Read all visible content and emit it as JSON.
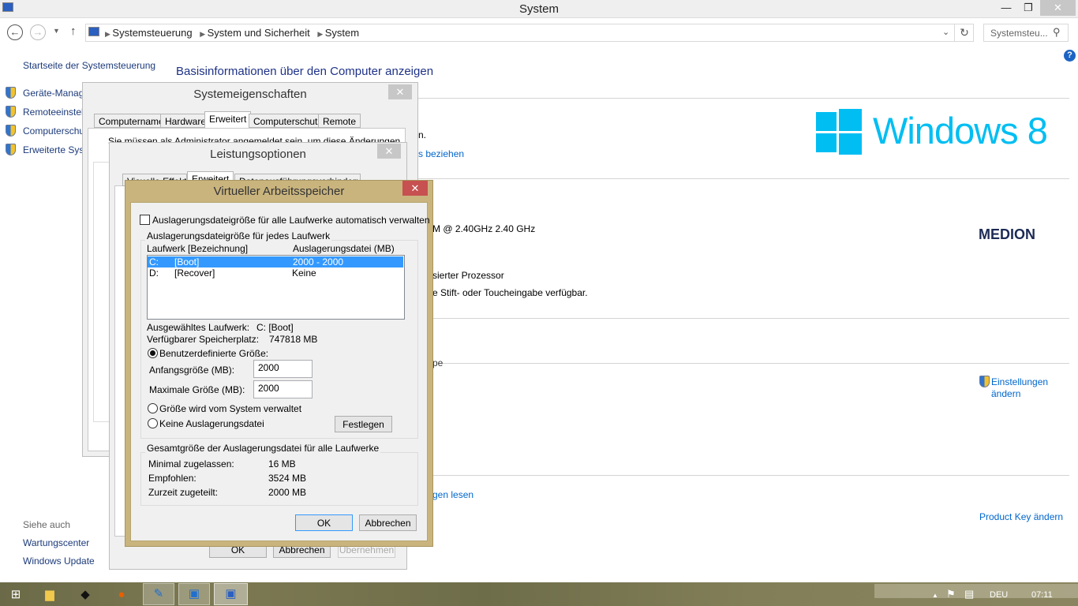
{
  "window": {
    "title": "System",
    "minimize": "—",
    "restore": "❐",
    "close": "✕"
  },
  "nav": {
    "breadcrumb": [
      "Systemsteuerung",
      "System und Sicherheit",
      "System"
    ],
    "search_placeholder": "Systemsteu..."
  },
  "sidebar": {
    "home": "Startseite der Systemsteuerung",
    "items": [
      {
        "label": "Geräte-Manag"
      },
      {
        "label": "Remoteeinstel"
      },
      {
        "label": "Computerschu"
      },
      {
        "label": "Erweiterte Syst"
      }
    ],
    "see_also": "Siehe auch",
    "see_also_items": [
      "Wartungscenter",
      "Windows Update"
    ]
  },
  "main": {
    "heading": "Basisinformationen über den Computer anzeigen",
    "frag1": "n.",
    "frag2": "s beziehen",
    "cpu": "M @ 2.40GHz   2.40 GHz",
    "frag3": "sierter Prozessor",
    "frag4": "e Stift- oder Toucheingabe verfügbar.",
    "frag5": "pe",
    "frag6": "gen lesen",
    "windows_logo": "Windows 8",
    "oem_logo": "MEDION",
    "settings_link_1": "Einstellungen",
    "settings_link_2": "ändern",
    "product_key": "Product Key ändern",
    "help": "?"
  },
  "sysprops": {
    "title": "Systemeigenschaften",
    "close": "✕",
    "tabs": [
      "Computername",
      "Hardware",
      "Erweitert",
      "Computerschutz",
      "Remote"
    ],
    "notice": "Sie müssen als Administrator angemeldet sein, um diese Änderungen"
  },
  "perf": {
    "title": "Leistungsoptionen",
    "close": "✕",
    "tabs": [
      "Visuelle Effekte",
      "Erweitert",
      "Datenausführungsverhinderung"
    ],
    "ok": "OK",
    "cancel": "Abbrechen",
    "apply": "Übernehmen"
  },
  "vm": {
    "title": "Virtueller Arbeitsspeicher",
    "close": "✕",
    "auto_manage": "Auslagerungsdateigröße für alle Laufwerke automatisch verwalten",
    "auto_manage_checked": false,
    "group1": "Auslagerungsdateigröße für jedes Laufwerk",
    "columns": [
      "Laufwerk [Bezeichnung]",
      "Auslagerungsdatei (MB)"
    ],
    "drives": [
      {
        "letter": "C:",
        "label": "[Boot]",
        "size": "2000 - 2000",
        "selected": true
      },
      {
        "letter": "D:",
        "label": "[Recover]",
        "size": "Keine",
        "selected": false
      }
    ],
    "selected_drive_label": "Ausgewähltes Laufwerk:",
    "selected_drive_value": "C:  [Boot]",
    "free_space_label": "Verfügbarer Speicherplatz:",
    "free_space_value": "747818 MB",
    "custom_size": "Benutzerdefinierte Größe:",
    "initial_label": "Anfangsgröße (MB):",
    "initial_value": "2000",
    "max_label": "Maximale Größe (MB):",
    "max_value": "2000",
    "system_managed": "Größe wird vom System verwaltet",
    "no_paging": "Keine Auslagerungsdatei",
    "set": "Festlegen",
    "selected_option": "custom",
    "group2": "Gesamtgröße der Auslagerungsdatei für alle Laufwerke",
    "totals": [
      {
        "label": "Minimal zugelassen:",
        "value": "16 MB"
      },
      {
        "label": "Empfohlen:",
        "value": "3524 MB"
      },
      {
        "label": "Zurzeit zugeteilt:",
        "value": "2000 MB"
      }
    ],
    "ok": "OK",
    "cancel": "Abbrechen"
  },
  "taskbar": {
    "language": "DEU",
    "time": "07:11"
  },
  "colors": {
    "accent": "#3399ff",
    "link": "#0066cc",
    "heading": "#1e3287",
    "vm_frame": "#c9b47e",
    "close_red": "#c75050",
    "win8": "#00bef2",
    "medion": "#1c2a55"
  }
}
